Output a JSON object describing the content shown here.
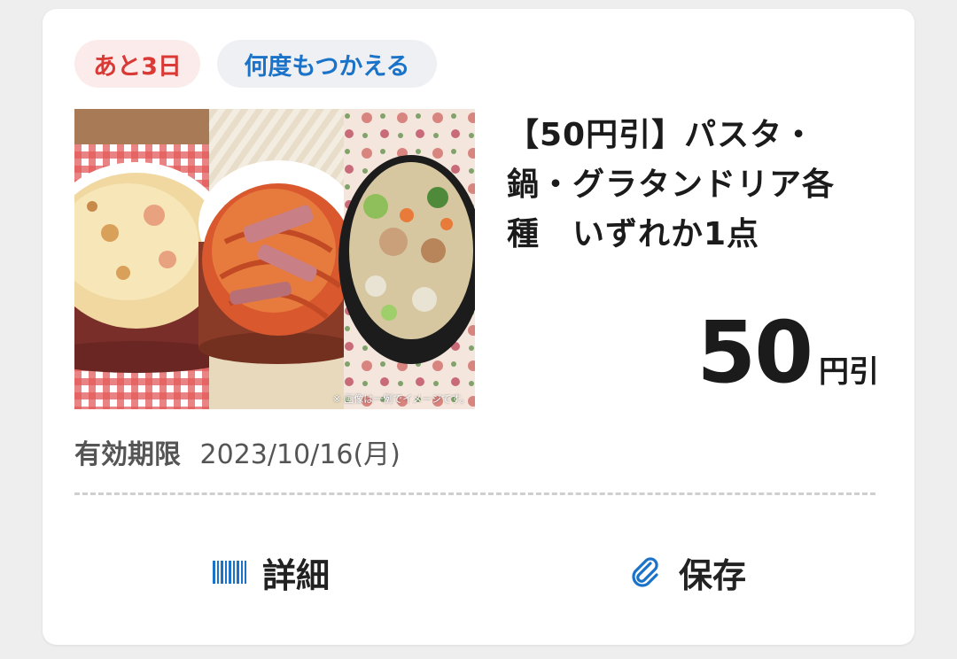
{
  "colors": {
    "days_badge_text": "#d93a35",
    "days_badge_bg": "#fbeceb",
    "reuse_badge_text": "#1a73c8",
    "reuse_badge_bg": "#eef0f4",
    "accent_blue": "#1a73c8"
  },
  "badges": {
    "days_left": "あと3日",
    "reusable": "何度もつかえる"
  },
  "product_image": {
    "note": "※ 画像は一例でイメージです。"
  },
  "coupon": {
    "title": "【50円引】パスタ・\n鍋・グラタンドリア各\n種　いずれか1点",
    "discount_amount": "50",
    "discount_unit": "円引"
  },
  "expiry": {
    "label": "有効期限",
    "date": "2023/10/16(月)"
  },
  "actions": {
    "details_label": "詳細",
    "details_icon": "barcode-icon",
    "save_label": "保存",
    "save_icon": "paperclip-icon"
  }
}
